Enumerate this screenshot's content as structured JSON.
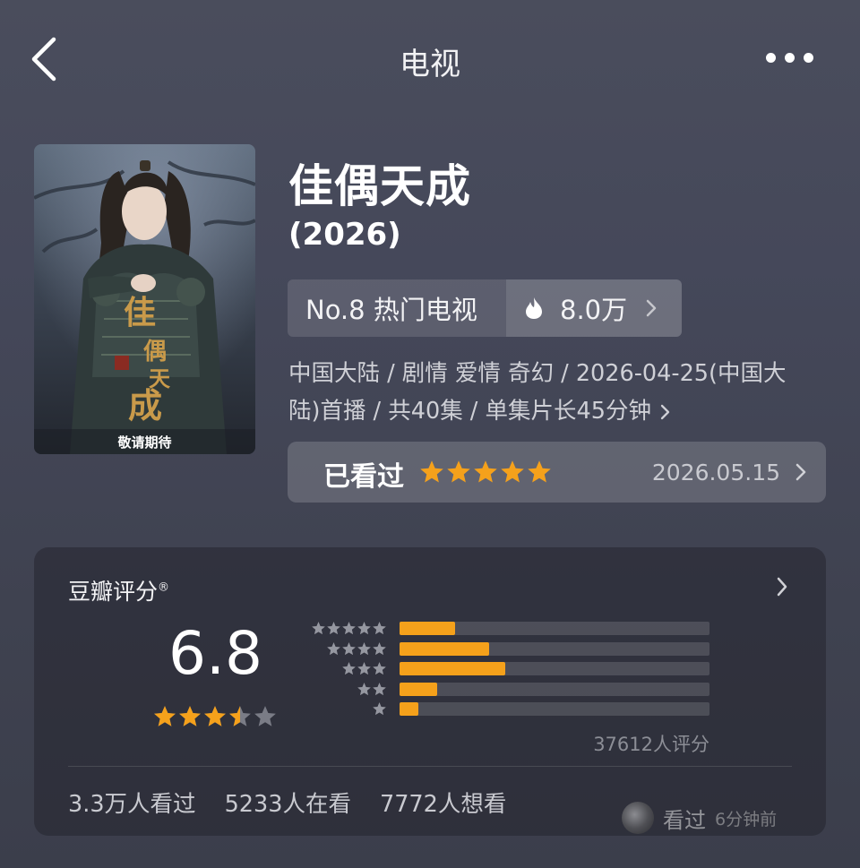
{
  "header": {
    "title": "电视",
    "back_icon": "chevron-left-icon",
    "more_icon": "more-dots-icon"
  },
  "poster": {
    "caption": "敬请期待",
    "calligraphy": "佳偶天成"
  },
  "show": {
    "title": "佳偶天成",
    "year": "(2026)"
  },
  "ranking": {
    "rank_label": "No.8 热门电视",
    "heat_value": "8.0万"
  },
  "meta": {
    "line1": "中国大陆 / 剧情 爱情 奇幻 / 2026-04-25(中国大",
    "line2": "陆)首播 / 共40集 / 单集片长45分钟"
  },
  "watched": {
    "label": "已看过",
    "stars": 5,
    "date": "2026.05.15"
  },
  "douban": {
    "title": "豆瓣评分",
    "title_mark": "®",
    "score": "6.8",
    "score_stars": 3.5,
    "distribution": [
      {
        "stars": 5,
        "fraction": 0.18
      },
      {
        "stars": 4,
        "fraction": 0.29
      },
      {
        "stars": 3,
        "fraction": 0.34
      },
      {
        "stars": 2,
        "fraction": 0.12
      },
      {
        "stars": 1,
        "fraction": 0.06
      }
    ],
    "rating_count": "37612人评分",
    "stats": {
      "watched": "3.3万人看过",
      "watching": "5233人在看",
      "want": "7772人想看"
    },
    "activity": {
      "label": "看过",
      "time": "6分钟前"
    }
  },
  "colors": {
    "accent_orange": "#f5a11b",
    "background": "#45485a"
  }
}
